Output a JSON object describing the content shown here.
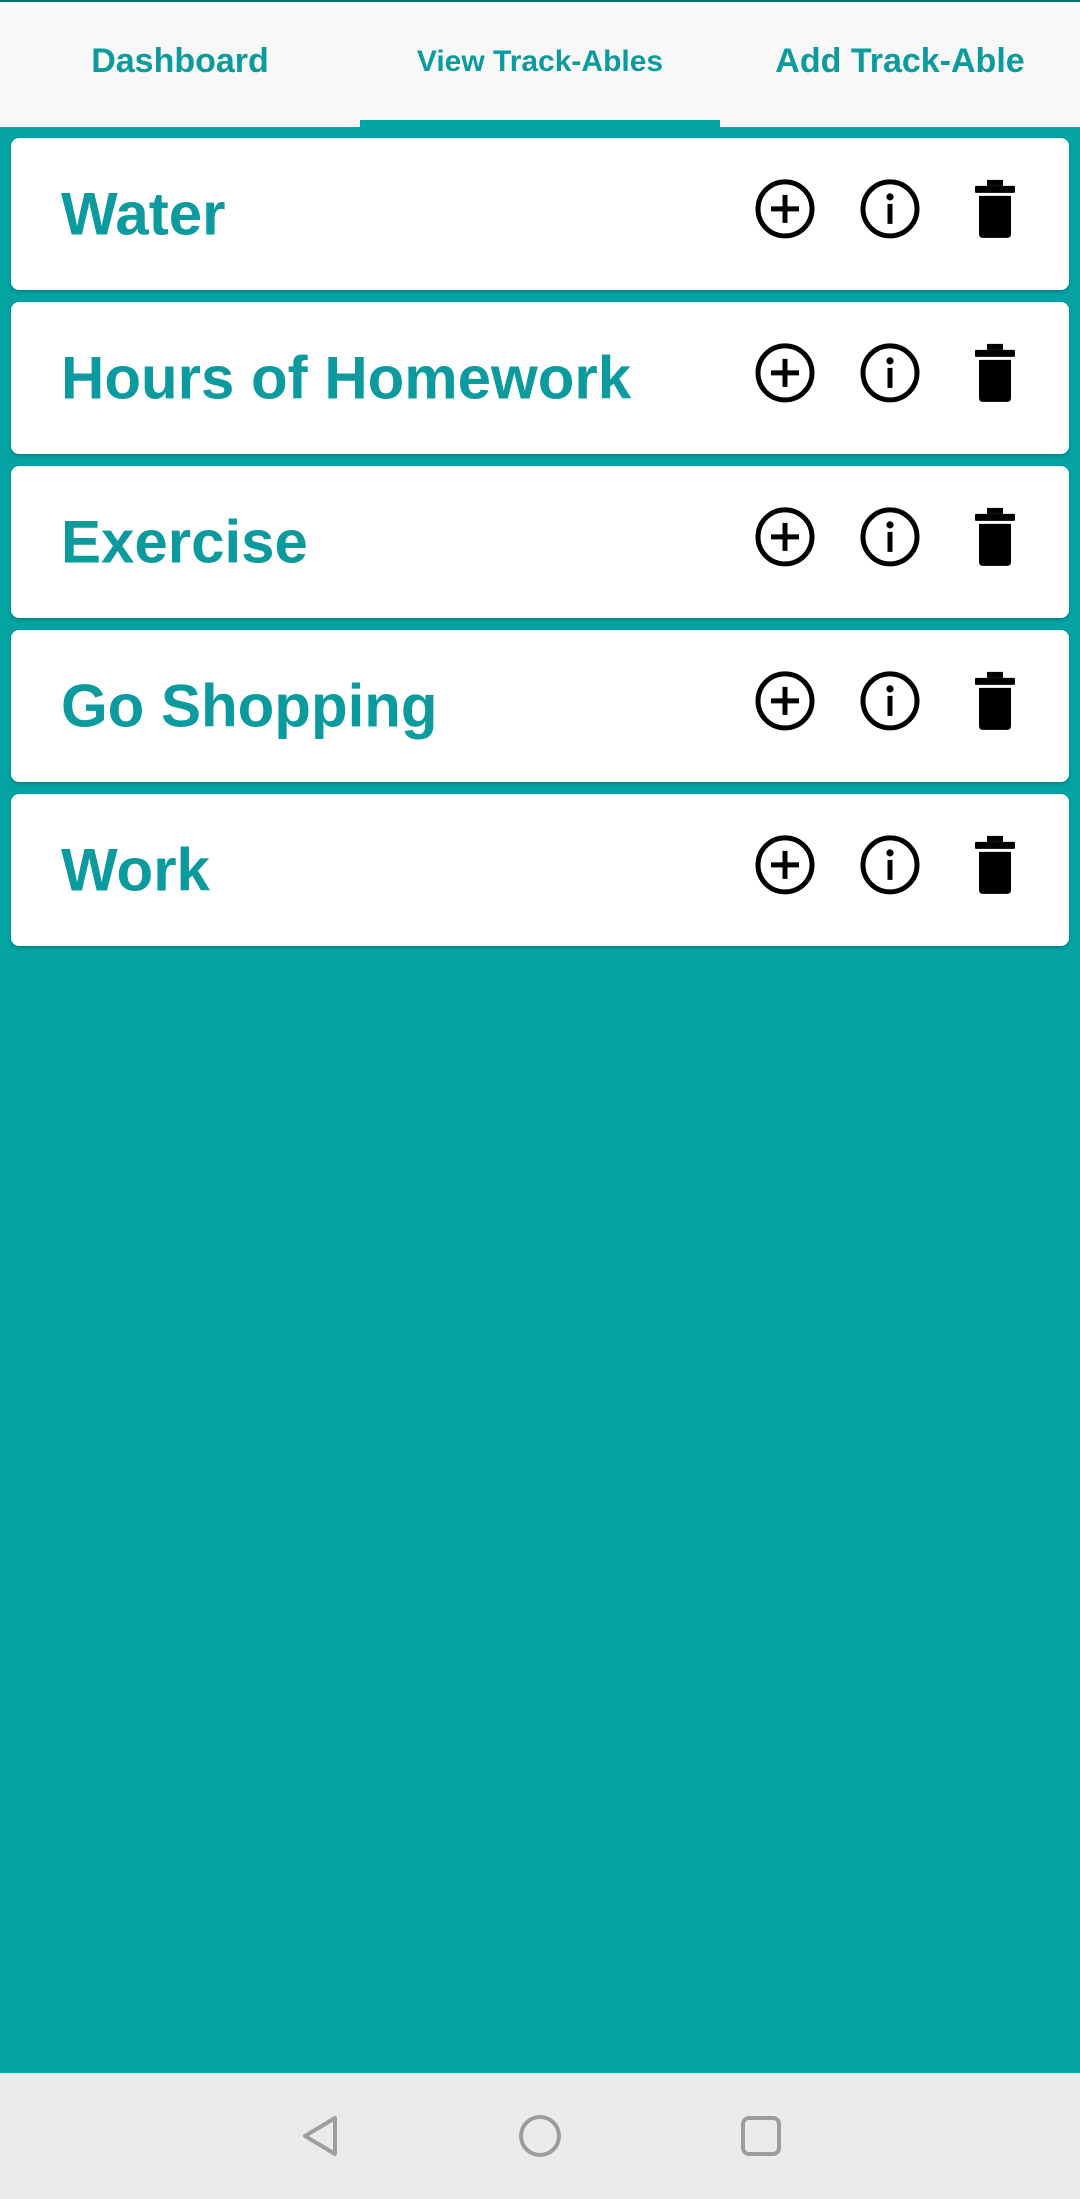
{
  "tabs": [
    {
      "label": "Dashboard",
      "active": false
    },
    {
      "label": "View Track-Ables",
      "active": true
    },
    {
      "label": "Add Track-Able",
      "active": false
    }
  ],
  "trackables": [
    {
      "name": "Water"
    },
    {
      "name": "Hours of Homework"
    },
    {
      "name": "Exercise"
    },
    {
      "name": "Go Shopping"
    },
    {
      "name": "Work"
    }
  ],
  "icons": {
    "add": "plus-circle-icon",
    "info": "info-circle-icon",
    "delete": "trash-icon"
  },
  "navigation": {
    "back": "back-triangle-icon",
    "home": "home-circle-icon",
    "recents": "recents-square-icon"
  },
  "colors": {
    "accent": "#03A2A3",
    "text": "#0B9A9D",
    "tabbar": "#F8F8F8",
    "card": "#FFFFFF",
    "navbar": "#EBEBEB"
  }
}
